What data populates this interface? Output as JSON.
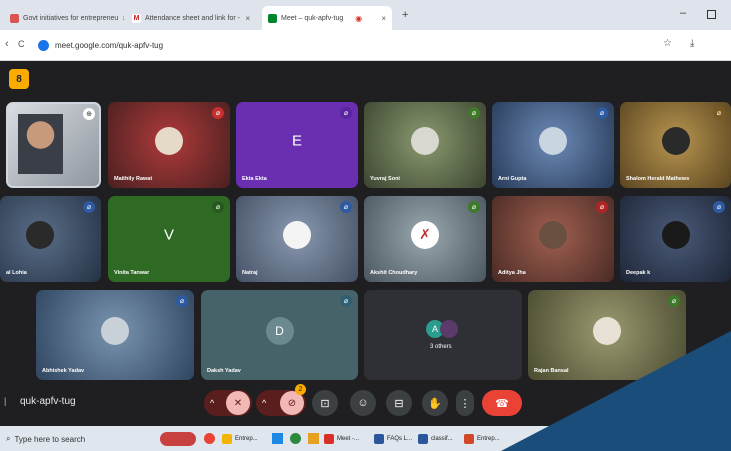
{
  "browser": {
    "tabs": [
      {
        "title": "Govt initiatives for entrepreneu",
        "close": "×",
        "favicon_color": "#d9534f"
      },
      {
        "title": "Attendance sheet and link for -",
        "close": "×",
        "favicon_color": "#c5221f",
        "favicon_label": "M"
      },
      {
        "title": "Meet – quk-apfv-tug",
        "close": "×",
        "favicon_color": "#00832d",
        "recording_dot": "◉"
      }
    ],
    "new_tab": "+",
    "url": "meet.google.com/quk-apfv-tug",
    "back": "‹",
    "reload": "C",
    "star": "☆",
    "download": "⤓",
    "minimize": "–"
  },
  "meet": {
    "top_badge": "8",
    "meeting_code": "quk-apfv-tug",
    "row1": [
      {
        "name": "",
        "bg": "#9aa0a6",
        "type": "video"
      },
      {
        "name": "Maithily Rawat",
        "bg": "#8b2c2c",
        "type": "photo",
        "mic_color": "#c53030"
      },
      {
        "name": "Ekta Ekta",
        "bg": "#6a2fb0",
        "type": "letter",
        "letter": "E",
        "mic_color": "#6a2fb0"
      },
      {
        "name": "Yuvraj Soni",
        "bg": "#5f6b4a",
        "type": "photo",
        "mic_color": "#3e7a2a"
      },
      {
        "name": "Arni Gupta",
        "bg": "#3a5a8a",
        "type": "photo",
        "mic_color": "#2d5aa0"
      },
      {
        "name": "Shalom Herald Mathews",
        "bg": "#8a6a2a",
        "type": "photo",
        "mic_color": "#7a5a20"
      }
    ],
    "row2": [
      {
        "name": "al Lohia",
        "bg": "#3d4e66",
        "type": "photo",
        "mic_color": "#2d5aa0"
      },
      {
        "name": "Vinita Tanwar",
        "bg": "#2e6a24",
        "type": "letter",
        "letter": "V",
        "mic_color": "#2e6a24"
      },
      {
        "name": "Natraj",
        "bg": "#5c6f8a",
        "type": "photo",
        "mic_color": "#2d5aa0"
      },
      {
        "name": "Akshit Choudhary",
        "bg": "#6f7f88",
        "type": "photo",
        "mic_color": "#3e7a2a"
      },
      {
        "name": "Aditya Jha",
        "bg": "#7a4a40",
        "type": "photo",
        "mic_color": "#b02525"
      },
      {
        "name": "Deepak k",
        "bg": "#2f3d55",
        "type": "photo",
        "mic_color": "#2d5aa0"
      }
    ],
    "row3": [
      {
        "name": "Abhishek Yadav",
        "bg": "#4e6a88",
        "type": "photo",
        "mic_color": "#2d5aa0"
      },
      {
        "name": "Daksh Yadav",
        "bg": "#46636a",
        "type": "letter",
        "letter": "D",
        "mic_color": "#2f5f70"
      },
      {
        "name": "3 others",
        "bg": "#2e3035",
        "type": "others",
        "letter": "A"
      },
      {
        "name": "Rajan Bansal",
        "bg": "#6a6a50",
        "type": "photo",
        "mic_color": "#3e7a2a"
      }
    ],
    "controls": {
      "caret": "^",
      "mic": "🎙",
      "cam": "⊘",
      "present": "⊡",
      "emoji": "☺",
      "captions": "⊟",
      "hand": "✋",
      "more": "⋮",
      "end": "☎",
      "badge": "2"
    }
  },
  "taskbar": {
    "search_placeholder": "Type here to search",
    "items": [
      {
        "label": "Entrep...",
        "color": "#f2b400"
      },
      {
        "label": "Meet -...",
        "color": "#d93025"
      },
      {
        "label": "FAQs L...",
        "color": "#2b579a"
      },
      {
        "label": "classif...",
        "color": "#2b579a"
      },
      {
        "label": "Entrep...",
        "color": "#d24726"
      }
    ]
  }
}
